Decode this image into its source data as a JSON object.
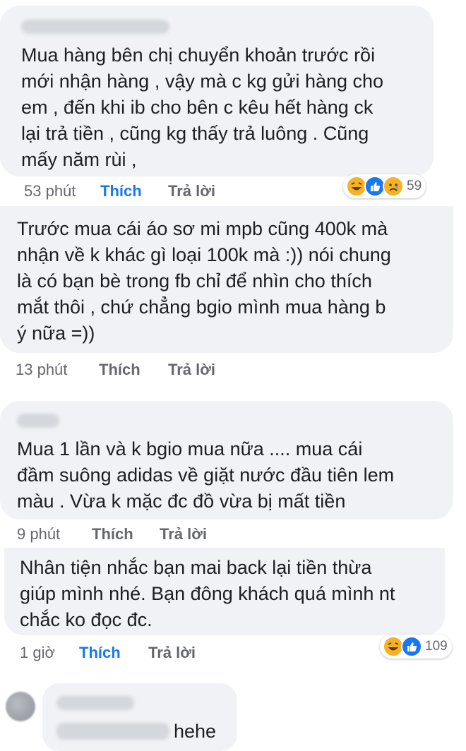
{
  "comments": [
    {
      "text_lines": [
        "Mua hàng bên chị chuyển khoản trước rồi",
        "mới nhận hàng , vậy mà c kg gửi hàng cho",
        "em , đến khi ib cho bên c kêu hết hàng ck",
        "lại trả tiền , cũng kg thấy trả luông . Cũng",
        "mấy năm rùi ,"
      ],
      "time": "53 phút",
      "like_label": "Thích",
      "like_active": true,
      "reply_label": "Trả lời",
      "reactions": [
        "haha",
        "like",
        "sad"
      ],
      "reaction_count": "59"
    },
    {
      "text_lines": [
        "Trước mua cái áo sơ mi mpb cũng 400k mà",
        "nhận về k khác gì loại 100k mà :)) nói chung",
        "là có bạn bè trong fb chỉ để nhìn cho thích",
        "mắt thôi , chứ chẳng bgio mình mua hàng b",
        "ý nữa =))"
      ],
      "time": "13 phút",
      "like_label": "Thích",
      "like_active": false,
      "reply_label": "Trả lời"
    },
    {
      "text_lines": [
        "Mua 1 lần và k bgio mua nữa .... mua cái",
        "đầm suông adidas về giặt nước đầu tiên lem",
        "màu . Vừa k mặc đc đồ vừa bị mất tiền"
      ],
      "time": "9 phút",
      "like_label": "Thích",
      "like_active": false,
      "reply_label": "Trả lời"
    },
    {
      "text_lines": [
        "Nhân tiện nhắc bạn mai back lại tiền thừa",
        "giúp mình nhé. Bạn đông khách quá mình nt",
        "chắc ko đọc đc."
      ],
      "time": "1 giờ",
      "like_label": "Thích",
      "like_active": true,
      "reply_label": "Trả lời",
      "reactions": [
        "haha",
        "like"
      ],
      "reaction_count": "109"
    },
    {
      "text_lines": [
        "hehe"
      ]
    }
  ],
  "colors": {
    "bubble": "#f0f2f5",
    "like_active": "#1877f2",
    "meta": "#65676b",
    "haha": "#f7b125",
    "like_icon": "#1877f2"
  }
}
